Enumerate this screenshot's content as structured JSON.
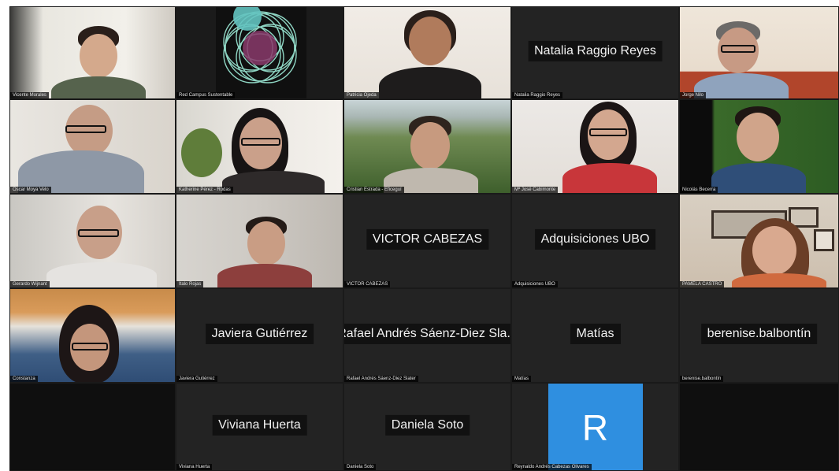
{
  "participants": [
    {
      "name": "Vicente Morales",
      "type": "video"
    },
    {
      "name": "Red Campus Sustentable",
      "type": "logo"
    },
    {
      "name": "Patricia Ojeda",
      "type": "video"
    },
    {
      "name": "Natalia Raggio Reyes",
      "type": "name_only",
      "display": "Natalia Raggio Reyes"
    },
    {
      "name": "Jorge Nilo",
      "type": "video"
    },
    {
      "name": "Oscar Moya Velo",
      "type": "video"
    },
    {
      "name": "Katherine Pérez - Rodas",
      "type": "video"
    },
    {
      "name": "Cristian Estrada - Eficeguí",
      "type": "video"
    },
    {
      "name": "Mª José Cabimonte",
      "type": "video"
    },
    {
      "name": "Nicolás Becerra",
      "type": "video"
    },
    {
      "name": "Gerardo Wijnant",
      "type": "video"
    },
    {
      "name": "Italo Rojas",
      "type": "video"
    },
    {
      "name": "VICTOR CABEZAS",
      "type": "name_only",
      "display": "VICTOR CABEZAS"
    },
    {
      "name": "Adquisiciones UBO",
      "type": "name_only",
      "display": "Adquisiciones UBO"
    },
    {
      "name": "PAMELA CASTRO",
      "type": "video"
    },
    {
      "name": "Constanza",
      "type": "video"
    },
    {
      "name": "Javiera Gutiérrez",
      "type": "name_only",
      "display": "Javiera Gutiérrez"
    },
    {
      "name": "Rafael Andrés Sáenz-Diez Slater",
      "type": "name_only",
      "display": "Rafael Andrés Sáenz-Diez Sla..."
    },
    {
      "name": "Matías",
      "type": "name_only",
      "display": "Matías"
    },
    {
      "name": "berenise.balbontín",
      "type": "name_only",
      "display": "berenise.balbontín"
    },
    {
      "name": "",
      "type": "empty"
    },
    {
      "name": "Viviana Huerta",
      "type": "name_only",
      "display": "Viviana Huerta"
    },
    {
      "name": "Daniela Soto",
      "type": "name_only",
      "display": "Daniela Soto"
    },
    {
      "name": "Reynaldo Andrés Cabezas Olivares",
      "type": "avatar",
      "initial": "R"
    },
    {
      "name": "",
      "type": "empty"
    }
  ],
  "colors": {
    "background": "#1a1a1a",
    "tile": "#232323",
    "avatar_blue": "#2f8fe0"
  }
}
